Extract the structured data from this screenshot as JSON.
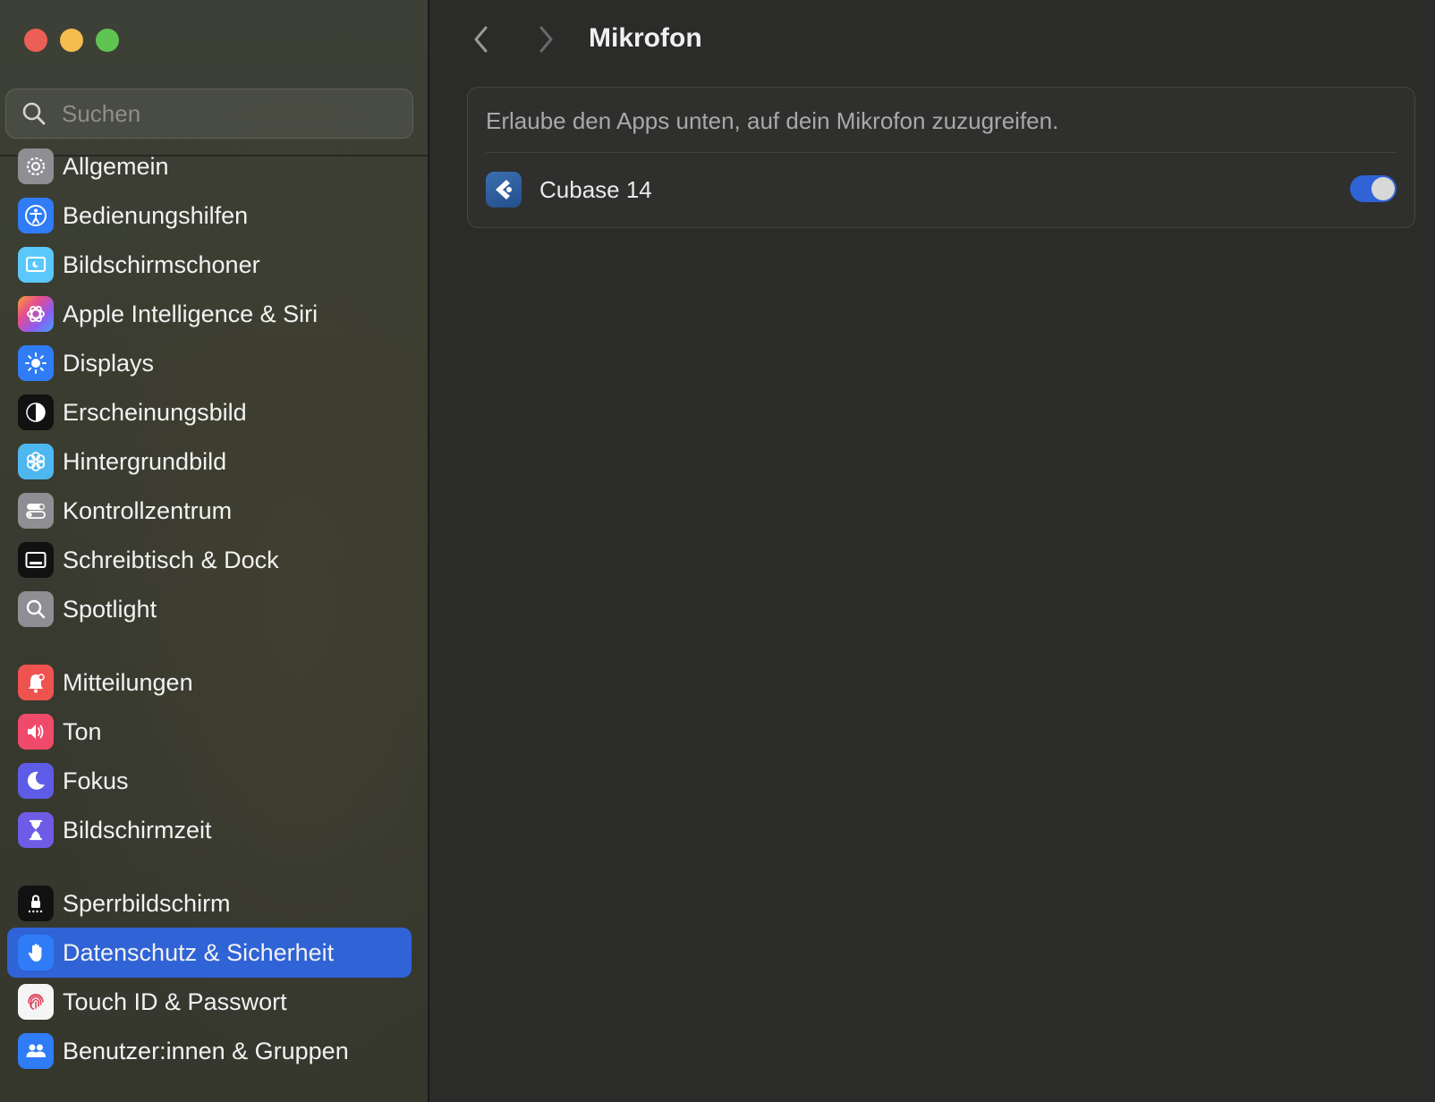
{
  "window": {
    "controls": [
      "close",
      "minimize",
      "maximize"
    ]
  },
  "search": {
    "placeholder": "Suchen",
    "value": ""
  },
  "sidebar": {
    "items": [
      {
        "label": "Allgemein",
        "icon": "gear-icon",
        "color": "#8e8e93"
      },
      {
        "label": "Bedienungshilfen",
        "icon": "accessibility-icon",
        "color": "#2f7cf6"
      },
      {
        "label": "Bildschirmschoner",
        "icon": "screensaver-icon",
        "color": "#5ac8fa"
      },
      {
        "label": "Apple Intelligence & Siri",
        "icon": "siri-icon",
        "color": "#c86dd7"
      },
      {
        "label": "Displays",
        "icon": "sun-icon",
        "color": "#2f7cf6"
      },
      {
        "label": "Erscheinungsbild",
        "icon": "appearance-icon",
        "color": "#111111"
      },
      {
        "label": "Hintergrundbild",
        "icon": "flower-icon",
        "color": "#4fb7f0"
      },
      {
        "label": "Kontrollzentrum",
        "icon": "control-center-icon",
        "color": "#8e8e93"
      },
      {
        "label": "Schreibtisch & Dock",
        "icon": "dock-icon",
        "color": "#111111"
      },
      {
        "label": "Spotlight",
        "icon": "magnifier-icon",
        "color": "#8e8e93"
      },
      {
        "label": "Mitteilungen",
        "icon": "bell-icon",
        "color": "#ef5350"
      },
      {
        "label": "Ton",
        "icon": "speaker-icon",
        "color": "#ef4a6a"
      },
      {
        "label": "Fokus",
        "icon": "moon-icon",
        "color": "#5e5ce6"
      },
      {
        "label": "Bildschirmzeit",
        "icon": "hourglass-icon",
        "color": "#6e5ce6"
      },
      {
        "label": "Sperrbildschirm",
        "icon": "lock-icon",
        "color": "#111111"
      },
      {
        "label": "Datenschutz & Sicherheit",
        "icon": "hand-icon",
        "color": "#2f7cf6",
        "active": true
      },
      {
        "label": "Touch ID & Passwort",
        "icon": "fingerprint-icon",
        "color": "#f5f5f5"
      },
      {
        "label": "Benutzer:innen & Gruppen",
        "icon": "users-icon",
        "color": "#2f7cf6"
      }
    ]
  },
  "main": {
    "title": "Mikrofon",
    "description": "Erlaube den Apps unten, auf dein Mikrofon zuzugreifen.",
    "apps": [
      {
        "name": "Cubase 14",
        "enabled": true,
        "icon": "cubase-icon"
      }
    ]
  },
  "colors": {
    "accent": "#2f63d6",
    "background": "#2b2b2a"
  }
}
